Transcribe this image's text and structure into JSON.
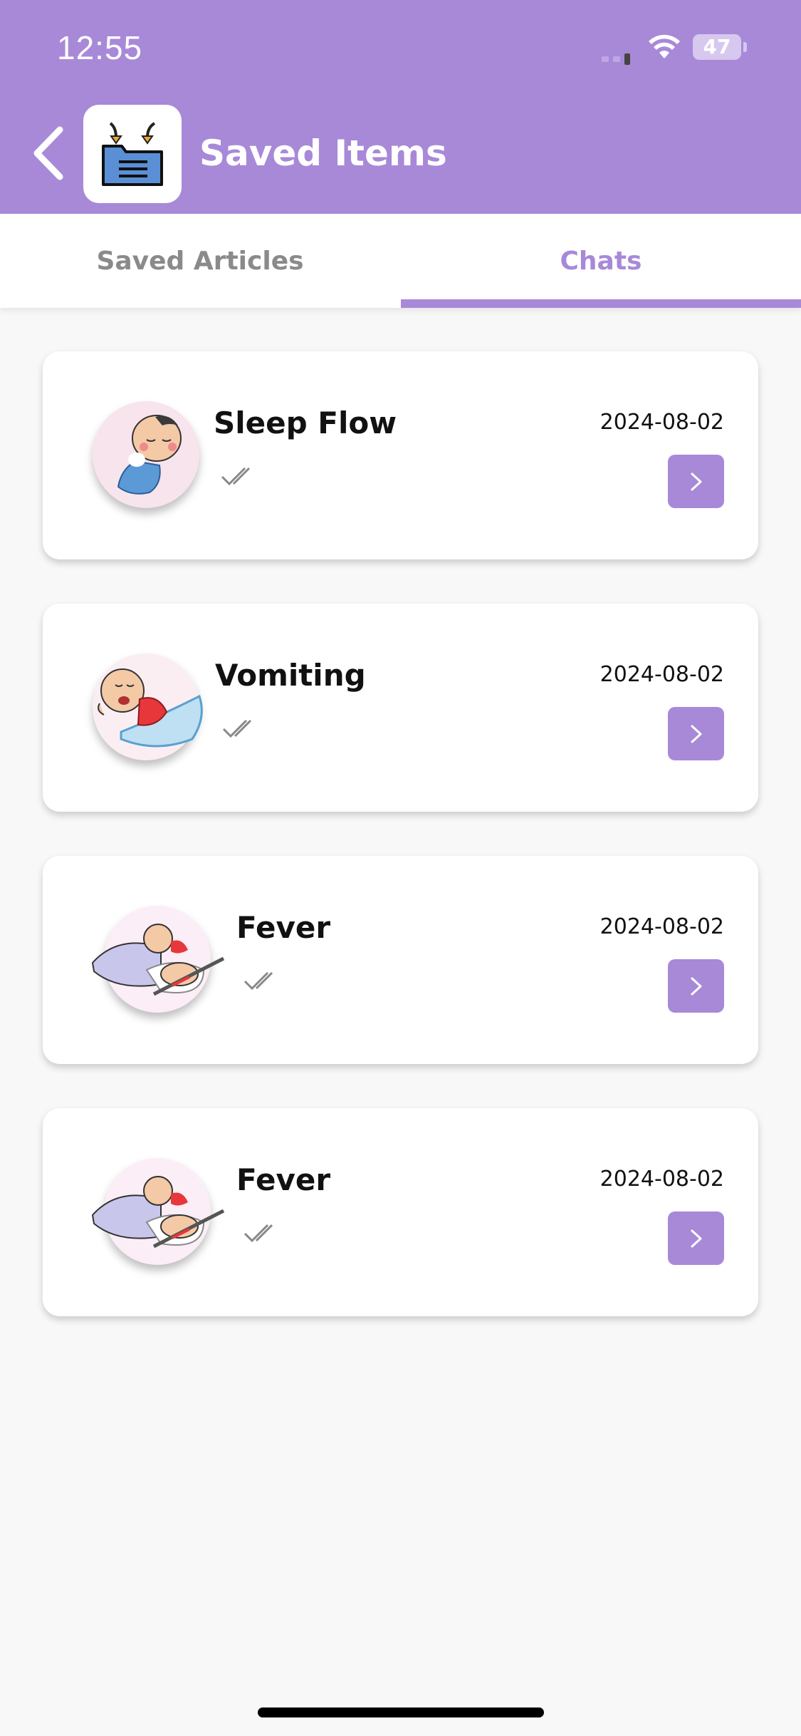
{
  "status_bar": {
    "time": "12:55",
    "battery": "47"
  },
  "header": {
    "title": "Saved Items",
    "back_icon": "chevron-left-icon",
    "app_icon": "saved-folder-icon"
  },
  "tabs": [
    {
      "label": "Saved Articles",
      "active": false
    },
    {
      "label": "Chats",
      "active": true
    }
  ],
  "chats": [
    {
      "title": "Sleep Flow",
      "date": "2024-08-02",
      "avatar": "sleeping-baby-illustration",
      "status_icon": "double-check-icon"
    },
    {
      "title": "Vomiting",
      "date": "2024-08-02",
      "avatar": "vomiting-baby-illustration",
      "status_icon": "double-check-icon"
    },
    {
      "title": "Fever",
      "date": "2024-08-02",
      "avatar": "fever-baby-illustration",
      "status_icon": "double-check-icon"
    },
    {
      "title": "Fever",
      "date": "2024-08-02",
      "avatar": "fever-baby-illustration",
      "status_icon": "double-check-icon"
    }
  ],
  "colors": {
    "accent": "#a889d8",
    "background": "#f8f8f8",
    "inactive_tab": "#8a8a8a"
  }
}
